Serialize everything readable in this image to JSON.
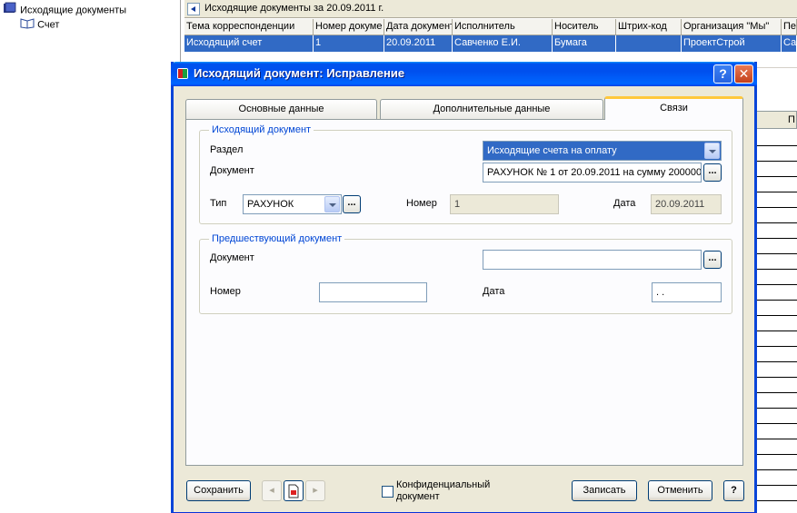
{
  "tree": {
    "root_label": "Исходящие документы",
    "child_label": "Счет"
  },
  "list": {
    "title": "Исходящие документы за 20.09.2011 г.",
    "columns": [
      "Тема корреспонденции",
      "Номер докуме",
      "Дата документ",
      "Исполнитель",
      "Носитель",
      "Штрих-код",
      "Организация \"Мы\"",
      "Пер"
    ],
    "row": [
      "Исходящий счет",
      "1",
      "20.09.2011",
      "Савченко Е.И.",
      "Бумага",
      "",
      "ПроектСтрой",
      "Са"
    ],
    "right_panel_label": "П"
  },
  "dialog": {
    "title": "Исходящий документ: Исправление",
    "help_label": "?",
    "close_label": "✕",
    "tabs": [
      "Основные данные",
      "Дополнительные данные",
      "Связи"
    ],
    "outgoing": {
      "legend": "Исходящий документ",
      "section_label": "Раздел",
      "section_value": "Исходящие счета на оплату",
      "document_label": "Документ",
      "document_value": "РАХУНОК № 1 от 20.09.2011 на сумму 200000",
      "type_label": "Тип",
      "type_value": "РАХУНОК",
      "number_label": "Номер",
      "number_value": "1",
      "date_label": "Дата",
      "date_value": "20.09.2011"
    },
    "previous": {
      "legend": "Предшествующий документ",
      "document_label": "Документ",
      "document_value": "",
      "number_label": "Номер",
      "number_value": "",
      "date_label": "Дата",
      "date_value": " .  ."
    },
    "buttons": {
      "save": "Сохранить",
      "confidential": "Конфиденциальный документ",
      "write": "Записать",
      "cancel": "Отменить",
      "help": "?",
      "dots": "..."
    }
  }
}
